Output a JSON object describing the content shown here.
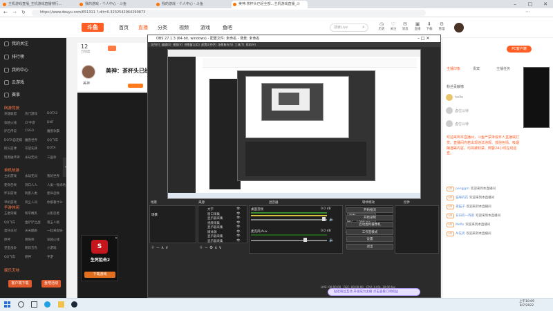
{
  "browser": {
    "tabs": [
      {
        "label": "主机游戏直播_主机游戏直播排行..."
      },
      {
        "label": "我的游戏 - 个人中心 - 斗鱼"
      },
      {
        "label": "我的游戏 - 个人中心 - 斗鱼"
      },
      {
        "label": "美神:茶杯头已经全部...主机游戏直播_斗"
      }
    ],
    "url": "https://www.douyu.com/651311 ?-dit=0.3232542964290873"
  },
  "header": {
    "logo": "斗鱼",
    "nav": [
      "首页",
      "直播",
      "分类",
      "视频",
      "游戏",
      "鱼吧"
    ],
    "active_nav": "直播",
    "search_placeholder": "搜索Live",
    "icons": [
      {
        "label": "历史",
        "icon": "history-icon"
      },
      {
        "label": "关注",
        "icon": "follow-icon"
      },
      {
        "label": "消息",
        "icon": "message-icon"
      },
      {
        "label": "直播",
        "icon": "live-icon"
      },
      {
        "label": "下载",
        "icon": "download-icon"
      },
      {
        "label": "管理",
        "icon": "manage-icon"
      }
    ]
  },
  "sidebar": {
    "top_items": [
      "我的关注",
      "排行榜",
      "我的中心",
      "云游戏",
      "赛事"
    ],
    "sections": [
      {
        "title": "网游竞技",
        "rows": [
          [
            "英雄联盟",
            "热门游戏",
            "DOTA2"
          ],
          [
            "穿越火线",
            "CF手游",
            "DNF"
          ],
          [
            "炉石传说",
            "CSGO",
            "魔兽争霸"
          ],
          [
            "DOTA自走棋",
            "魔兽世界",
            "QQ飞车"
          ],
          [
            "街头篮球",
            "守望先锋",
            "DOTA"
          ],
          [
            "暗黑破坏神",
            "永劫无间",
            "三国杀"
          ]
        ]
      },
      {
        "title": "单机热游",
        "rows": [
          [
            "主机游戏",
            "永劫无间",
            "我的世界"
          ],
          [
            "使命召唤",
            "洞口人人",
            "人类一败涂地"
          ],
          [
            "怀旧游戏",
            "刺客人类",
            "使命召唤"
          ],
          [
            "单机游戏",
            "风尘人间",
            "你都看什么"
          ]
        ]
      },
      {
        "title": "手游休闲",
        "rows": [
          [
            "王者荣耀",
            "和平精英",
            "火影忍者"
          ],
          [
            "QQ飞车",
            "金铲铲之战",
            "第五人格"
          ],
          [
            "蛋仔派对",
            "天天酷跑",
            "一起来捉妖"
          ],
          [
            "原神",
            "阴阳师",
            "穿越火线"
          ],
          [
            "皇室战争",
            "明日方舟",
            "小游戏"
          ],
          [
            "QQ飞车",
            "原神",
            "手游"
          ]
        ]
      },
      {
        "title": "娱乐天地",
        "rows": []
      }
    ],
    "bottom_buttons": [
      "客户端下载",
      "鱼吧活动"
    ]
  },
  "stream": {
    "view_count": "12",
    "view_unit": "万热度",
    "title": "美神：茶杯头已经全",
    "streamer": "美神",
    "promo_title": "生死狙击2",
    "promo_button": "下载游戏"
  },
  "obs": {
    "title": "OBS 27.1.3 (64-bit, windows) - 配置文件: 未命名 - 场景: 未命名",
    "menu": [
      "文件(F)",
      "编辑(E)",
      "视图(V)",
      "停靠窗口(D)",
      "配置文件(P)",
      "场景集合(S)",
      "工具(T)",
      "帮助(H)"
    ],
    "docks": {
      "scenes_title": "场景",
      "sources_title": "来源",
      "mixer_title": "混音器",
      "transitions_title": "转场特效",
      "controls_title": "控件"
    },
    "scene_name": "场景",
    "sources": [
      "文字",
      "窗口采集",
      "显示器采集",
      "视频采集",
      "显示器采集",
      "媒体源",
      "显示器采集",
      "显示器采集"
    ],
    "mixer": [
      {
        "name": "桌面音频",
        "level": "0.0 dB"
      },
      {
        "name": "麦克风/Aux",
        "level": "0.0 dB"
      }
    ],
    "transition": {
      "type": "淡出",
      "duration_label": "时长",
      "duration": "300 ms"
    },
    "controls": [
      "开始推流",
      "开始录制",
      "启动虚拟摄像机",
      "工作室模式",
      "设置",
      "退出"
    ],
    "status": {
      "live": "LIVE: 00:00:00",
      "rec": "REC: 00:00:00",
      "cpu": "CPU: 4.0%, 30.00 fps"
    }
  },
  "chat": {
    "tabs": [
      "主播印象",
      "贵宾",
      "主播任务"
    ],
    "pc_button": "PC客户端",
    "rank_title": "粉丝贡献榜",
    "rank_users": [
      "hello",
      "虚位以待",
      "虚位以待"
    ],
    "notice": "欢迎来到本直播间，斗鱼严禁未成年人直播或打赏。直播间内若出现违法违规、低俗色情、吸烟酗酒等内容，均将被封禁。网警24小时在线巡查。",
    "messages": [
      {
        "tag": "LV",
        "nick": "pengjgm",
        "text": "欢迎来到本直播间"
      },
      {
        "tag": "LV",
        "nick": "猫咪的花",
        "text": "欢迎来到本直播间"
      },
      {
        "tag": "LV",
        "nick": "夜猫子",
        "text": "欢迎来到本直播间"
      },
      {
        "tag": "LV",
        "nick": "日日的一阵雨",
        "text": "欢迎来到本直播间"
      },
      {
        "tag": "LV",
        "nick": "Meflo",
        "text": "欢迎来到本直播间"
      },
      {
        "tag": "LV",
        "nick": "AI先贤",
        "text": "欢迎来到本直播间"
      }
    ],
    "gift_banner": "贴近粉丝互动 升级成为主播  点击查看订阅权益"
  },
  "taskbar": {
    "time": "上午10:09",
    "date": "8/7/2022"
  },
  "colors": {
    "brand": "#ff5d23",
    "sidebar": "#222222",
    "obs_bg": "#2b2b2b"
  }
}
